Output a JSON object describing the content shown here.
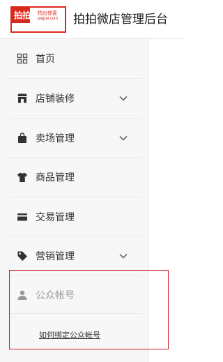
{
  "header": {
    "logo": {
      "main_text": "拍拍",
      "sub_text": "拍出惊喜",
      "url_text": "paipai.com"
    },
    "app_title": "拍拍微店管理后台"
  },
  "sidebar": {
    "items": [
      {
        "label": "首页",
        "icon": "grid-icon",
        "has_chevron": false
      },
      {
        "label": "店铺装修",
        "icon": "store-icon",
        "has_chevron": true
      },
      {
        "label": "卖场管理",
        "icon": "shopping-bag-icon",
        "has_chevron": true
      },
      {
        "label": "商品管理",
        "icon": "tshirt-icon",
        "has_chevron": false
      },
      {
        "label": "交易管理",
        "icon": "credit-card-icon",
        "has_chevron": false
      },
      {
        "label": "营销管理",
        "icon": "tag-icon",
        "has_chevron": true
      },
      {
        "label": "公众帐号",
        "icon": "user-icon",
        "has_chevron": false
      }
    ],
    "help_link": "如何绑定公众帐号"
  },
  "colors": {
    "brand_red": "#d9291c",
    "highlight_border": "#cc2020",
    "sidebar_bg": "#f7f7f7",
    "muted_text": "#999999"
  }
}
